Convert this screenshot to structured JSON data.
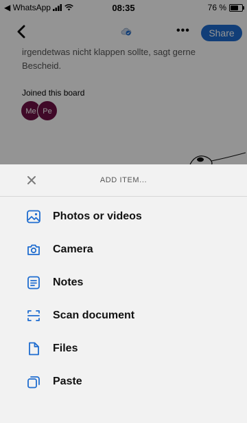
{
  "status_bar": {
    "back_app": "◀ WhatsApp",
    "time": "08:35",
    "battery": "76 %"
  },
  "nav": {
    "back_glyph": "<",
    "more_glyph": "•••",
    "share_label": "Share"
  },
  "board": {
    "description": "irgendetwas nicht klappen sollte, sagt gerne Bescheid.",
    "joined_label": "Joined this board",
    "members": [
      {
        "initials": "Me"
      },
      {
        "initials": "Pe"
      }
    ]
  },
  "sheet": {
    "title": "ADD ITEM...",
    "close_glyph": "✕",
    "items": [
      {
        "label": "Photos or videos",
        "icon": "image-icon"
      },
      {
        "label": "Camera",
        "icon": "camera-icon"
      },
      {
        "label": "Notes",
        "icon": "notes-icon"
      },
      {
        "label": "Scan document",
        "icon": "scan-icon"
      },
      {
        "label": "Files",
        "icon": "file-icon"
      },
      {
        "label": "Paste",
        "icon": "paste-icon"
      }
    ]
  },
  "colors": {
    "accent": "#1e6ccf",
    "avatar": "#6e1146",
    "sheet_bg": "#f2f2f2"
  }
}
